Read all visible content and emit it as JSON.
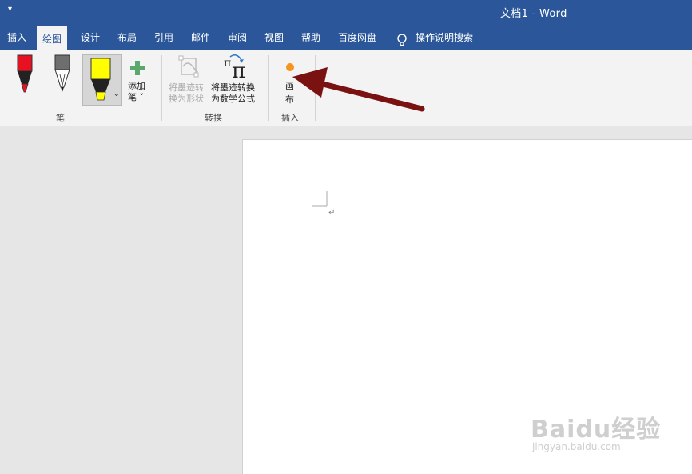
{
  "window": {
    "qat_glyph": "▾",
    "title": "文档1  -  Word"
  },
  "tabs": [
    {
      "label": "插入",
      "active": false
    },
    {
      "label": "绘图",
      "active": true
    },
    {
      "label": "设计",
      "active": false
    },
    {
      "label": "布局",
      "active": false
    },
    {
      "label": "引用",
      "active": false
    },
    {
      "label": "邮件",
      "active": false
    },
    {
      "label": "审阅",
      "active": false
    },
    {
      "label": "视图",
      "active": false
    },
    {
      "label": "帮助",
      "active": false
    },
    {
      "label": "百度网盘",
      "active": false
    }
  ],
  "tell_me": {
    "label": "操作说明搜索",
    "icon": "lightbulb-icon"
  },
  "ribbon": {
    "pens_group": {
      "label": "笔",
      "add_pen_line1": "添加",
      "add_pen_line2": "笔 ˅",
      "pens": [
        {
          "name": "red-pen",
          "color": "#e81123"
        },
        {
          "name": "black-pencil",
          "color": "#555555"
        },
        {
          "name": "yellow-highlighter",
          "color": "#ffff00"
        }
      ]
    },
    "convert_group": {
      "label": "转换",
      "ink_to_shape_line1": "将墨迹转",
      "ink_to_shape_line2": "换为形状",
      "ink_to_math_line1": "将墨迹转换",
      "ink_to_math_line2": "为数学公式"
    },
    "insert_group": {
      "label": "插入",
      "canvas_line1": "画",
      "canvas_line2": "布"
    }
  },
  "document": {
    "paragraph_mark": "↵"
  },
  "colors": {
    "title_bar": "#2b579a",
    "ribbon_bg": "#f3f3f3",
    "annotation_arrow": "#7a1212",
    "canvas_dot": "#f7941d"
  },
  "watermark": {
    "brand": "Baidu经验",
    "sub": "jingyan.baidu.com"
  }
}
